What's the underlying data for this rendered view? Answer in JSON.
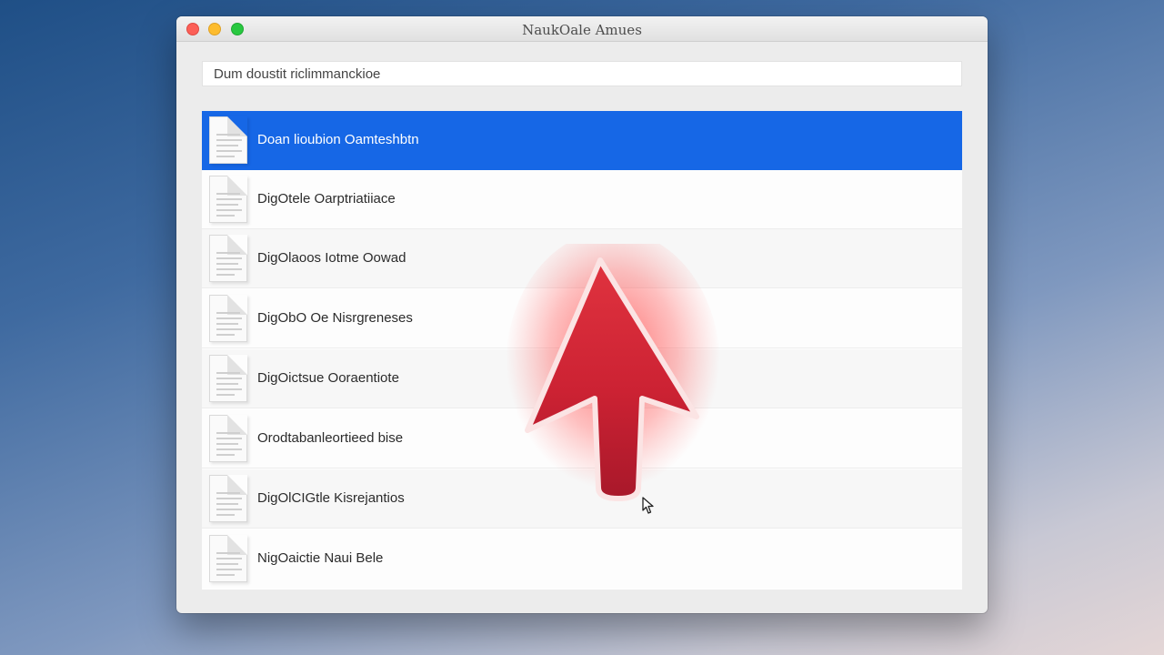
{
  "window": {
    "title": "NaukOale Amues"
  },
  "pathbar": {
    "text": "Dum doustit riclimmanckioe"
  },
  "list": {
    "items": [
      {
        "label": "Doan lioubion Oamteshbtn",
        "selected": true
      },
      {
        "label": "DigOtele Oarptriatiiace",
        "selected": false
      },
      {
        "label": "DigOlaoos Iotme Oowad",
        "selected": false
      },
      {
        "label": "DigObO Oe Nisrgreneses",
        "selected": false
      },
      {
        "label": "DigOictsue Ooraentiote",
        "selected": false
      },
      {
        "label": "Orodtabanleortieed bise",
        "selected": false
      },
      {
        "label": "DigOlCIGtle Kisrejantios",
        "selected": false
      },
      {
        "label": "NigOaictie Naui Bele",
        "selected": false
      }
    ]
  },
  "colors": {
    "selection": "#1667e6",
    "arrow": "#d62b3a",
    "glow": "#ff3b3b"
  },
  "icons": {
    "file": "document-icon",
    "pointer": "big-red-arrow-icon",
    "cursor": "mouse-cursor-icon"
  }
}
